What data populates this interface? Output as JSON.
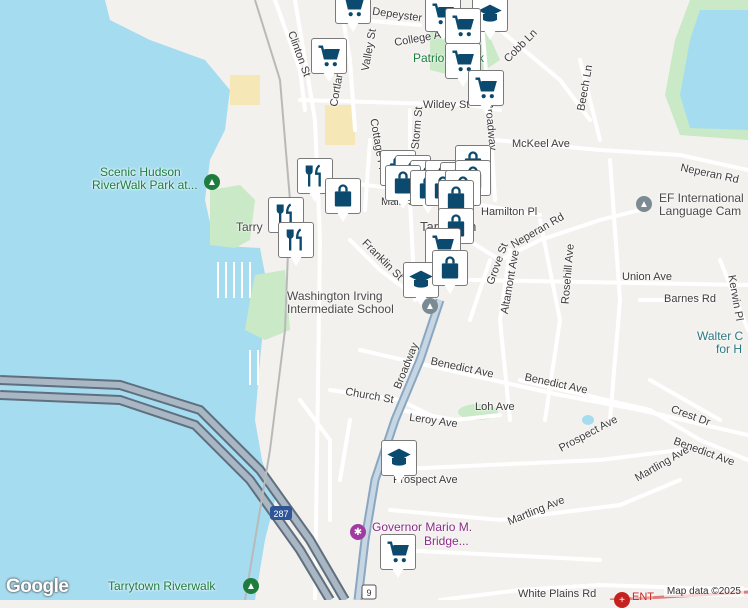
{
  "map": {
    "attribution": "Map data ©2025",
    "logo": "Google",
    "water_color": "#a6dcf0",
    "park_color": "#c9e9c7",
    "road_color": "#ffffff",
    "highway_color": "#8aa7c1",
    "marker_color": "#0b4a6e"
  },
  "streets": [
    {
      "name": "Depeyster St"
    },
    {
      "name": "College Ave"
    },
    {
      "name": "Cobb Ln"
    },
    {
      "name": "Clinton St"
    },
    {
      "name": "Valley St"
    },
    {
      "name": "Cortlandt St"
    },
    {
      "name": "Wildey St"
    },
    {
      "name": "Beech Ln"
    },
    {
      "name": "McKeel Ave"
    },
    {
      "name": "Neperan Rd"
    },
    {
      "name": "Cottage Pl"
    },
    {
      "name": "Storm St"
    },
    {
      "name": "Broadway"
    },
    {
      "name": "Main St"
    },
    {
      "name": "Hamilton Pl"
    },
    {
      "name": "Neperan Rd"
    },
    {
      "name": "Franklin St"
    },
    {
      "name": "Grove St"
    },
    {
      "name": "Altamont Ave"
    },
    {
      "name": "Rosehill Ave"
    },
    {
      "name": "Union Ave"
    },
    {
      "name": "Barnes Rd"
    },
    {
      "name": "Kerwin Pl"
    },
    {
      "name": "Benedict Ave"
    },
    {
      "name": "Benedict Ave"
    },
    {
      "name": "Church St"
    },
    {
      "name": "Leroy Ave"
    },
    {
      "name": "Loh Ave"
    },
    {
      "name": "Broadway"
    },
    {
      "name": "Crest Dr"
    },
    {
      "name": "Benedict Ave"
    },
    {
      "name": "Prospect Ave"
    },
    {
      "name": "Prospect Ave"
    },
    {
      "name": "Martling Ave"
    },
    {
      "name": "Martling Ave"
    },
    {
      "name": "White Plains Rd"
    }
  ],
  "places": {
    "patriots_park": "Patriot's Park",
    "riverwalk_park_1": "Scenic Hudson",
    "riverwalk_park_2": "RiverWalk Park at...",
    "tarrytown_frag": "Tarry",
    "tarrytown": "Tarrytown",
    "ef_1": "EF International",
    "ef_2": "Language Cam",
    "walter_1": "Walter C",
    "walter_2": "for H",
    "school_1": "Washington Irving",
    "school_2": "Intermediate School",
    "bridge_1": "Governor Mario M.",
    "bridge_2": "Bridge...",
    "riverwalk": "Tarrytown Riverwalk",
    "ent": "ENT",
    "route_287": "287",
    "route_9": "9"
  },
  "markers": [
    {
      "type": "shopping-cart"
    },
    {
      "type": "shopping-cart"
    },
    {
      "type": "school"
    },
    {
      "type": "shopping-cart"
    },
    {
      "type": "shopping-cart"
    },
    {
      "type": "shopping-cart"
    },
    {
      "type": "school"
    },
    {
      "type": "restaurant"
    },
    {
      "type": "restaurant"
    },
    {
      "type": "restaurant"
    },
    {
      "type": "shopping-bag"
    },
    {
      "type": "shopping-bag"
    },
    {
      "type": "shopping-bag"
    },
    {
      "type": "shopping-bag"
    },
    {
      "type": "shopping-bag"
    },
    {
      "type": "shopping-bag"
    },
    {
      "type": "shopping-bag"
    },
    {
      "type": "shopping-bag"
    },
    {
      "type": "shopping-cart"
    },
    {
      "type": "shopping-cart"
    },
    {
      "type": "school"
    },
    {
      "type": "shopping-bag"
    },
    {
      "type": "school"
    },
    {
      "type": "shopping-cart"
    }
  ]
}
